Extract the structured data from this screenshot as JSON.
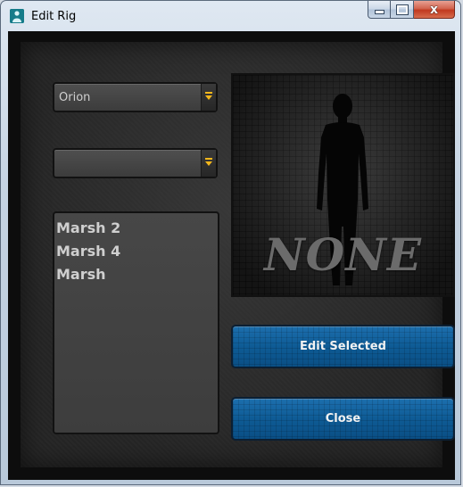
{
  "window": {
    "title": "Edit Rig",
    "icon": "app-rig-icon"
  },
  "caption_buttons": {
    "minimize": "minimize-icon",
    "maximize": "maximize-icon",
    "close_glyph": "x"
  },
  "rig_select": {
    "value": "Orion"
  },
  "secondary_select": {
    "value": ""
  },
  "rig_list": {
    "items": [
      "Marsh 2",
      "Marsh 4",
      "Marsh"
    ]
  },
  "preview": {
    "label": "NONE",
    "icon": "human-silhouette-icon"
  },
  "buttons": {
    "edit_selected": "Edit Selected",
    "close": "Close"
  },
  "colors": {
    "accent_blue": "#0d5a93",
    "dropdown_arrow": "#f3b71c",
    "panel_bg": "#262626"
  }
}
